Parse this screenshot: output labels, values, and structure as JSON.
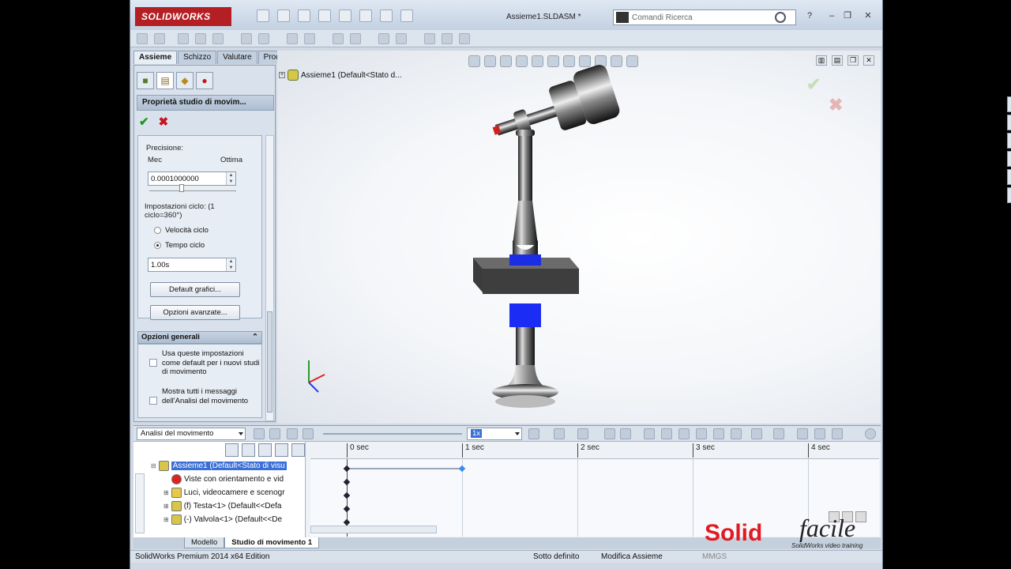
{
  "app": {
    "brand": "SOLIDWORKS",
    "document_title": "Assieme1.SLDASM *",
    "search_placeholder": "Comandi Ricerca",
    "brand_color": "#b41f24"
  },
  "command_tabs": [
    "Assieme",
    "Schizzo",
    "Valutare",
    "Prodotti Office"
  ],
  "property_manager": {
    "title": "Proprietà studio di movim...",
    "precision_label": "Precisione:",
    "slider_min_label": "Mec",
    "slider_max_label": "Ottima",
    "precision_value": "0.0001000000",
    "cycle_settings_label": "Impostazioni ciclo: (1 ciclo=360°)",
    "cycle_speed_label": "Velocità ciclo",
    "cycle_time_label": "Tempo ciclo",
    "cycle_time_value": "1.00s",
    "default_graphs_button": "Default grafici...",
    "advanced_options_button": "Opzioni avanzate...",
    "general_options_title": "Opzioni generali",
    "option1_text": "Usa queste impostazioni come default per i nuovi studi di movimento",
    "option2_text": "Mostra tutti i messaggi dell'Analisi del movimento"
  },
  "feature_tree": {
    "root_label": "Assieme1  (Default<Stato d..."
  },
  "motion_manager": {
    "study_type": "Analisi del movimento",
    "fps_value": "1x",
    "tree_rows": [
      "Assieme1  (Default<Stato di visu",
      "Viste con orientamento e vid",
      "Luci, videocamere e scenogr",
      "(f) Testa<1> (Default<<Defa",
      "(-) Valvola<1> (Default<<De"
    ],
    "time_labels": [
      "0 sec",
      "1 sec",
      "2 sec",
      "3 sec",
      "4 sec"
    ]
  },
  "bottom_tabs": [
    "Modello",
    "Studio di movimento 1"
  ],
  "status_bar": {
    "edition": "SolidWorks Premium 2014 x64 Edition",
    "state": "Sotto definito",
    "mode": "Modifica Assieme",
    "units": "MMGS"
  },
  "watermark": {
    "word1": "Solid",
    "word2": "facile",
    "tagline": "SolidWorks video training"
  }
}
